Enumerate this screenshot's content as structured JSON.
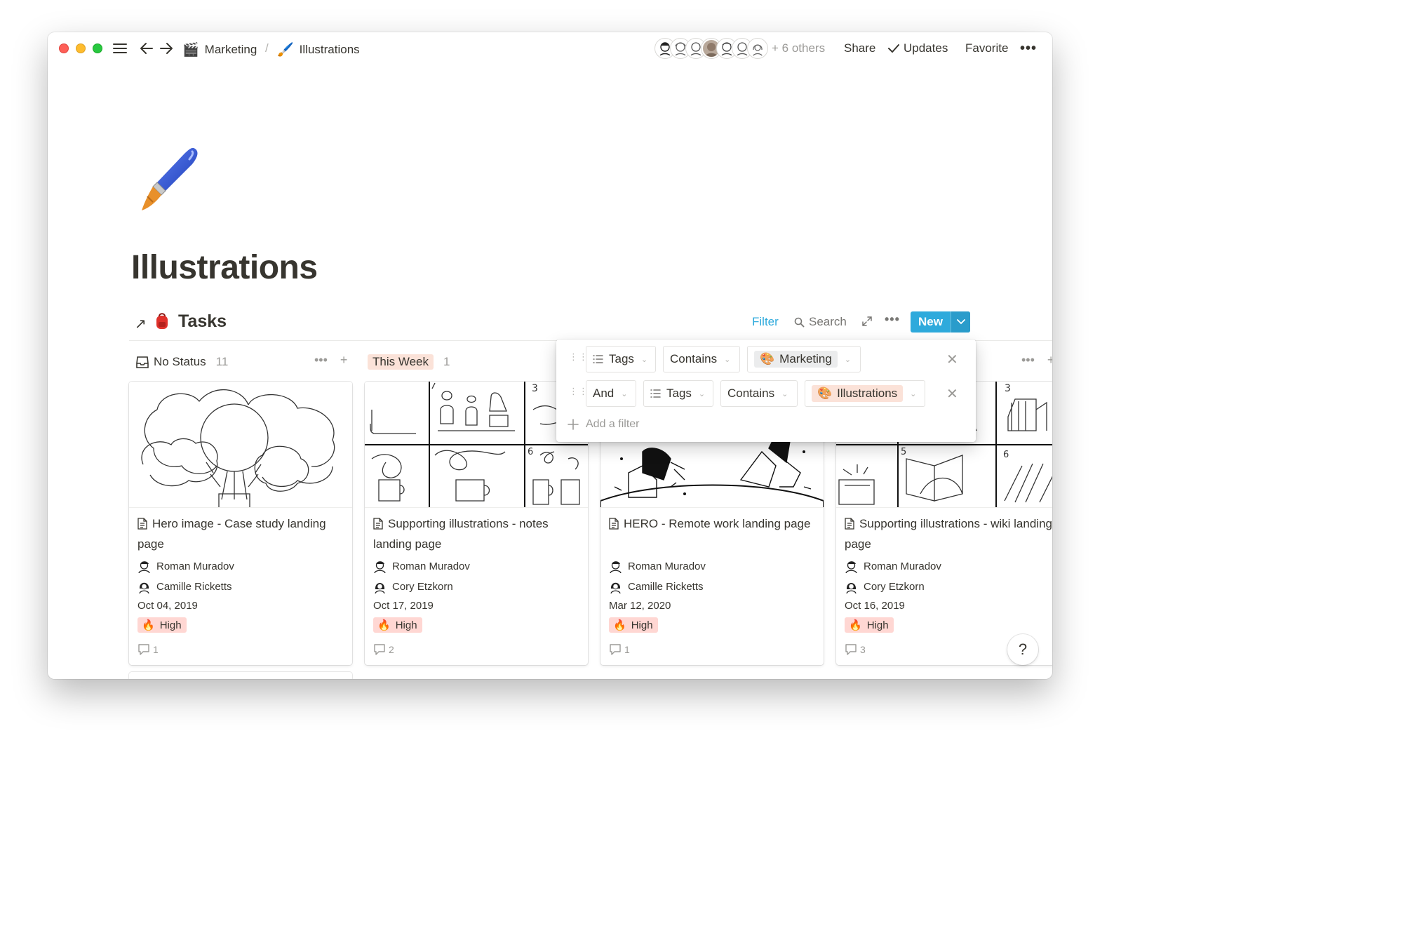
{
  "topbar": {
    "breadcrumb": [
      {
        "icon": "clapperboard-icon",
        "emoji": "🎬",
        "label": "Marketing"
      },
      {
        "icon": "paintbrush-icon",
        "emoji": "🖌️",
        "label": "Illustrations"
      }
    ],
    "separator": "/",
    "others": "+ 6 others",
    "share": "Share",
    "updates": "Updates",
    "favorite": "Favorite",
    "more": "•••"
  },
  "page": {
    "icon": "paintbrush-icon",
    "title": "Illustrations"
  },
  "database": {
    "link_arrow": "↗",
    "icon_emoji": "🎒",
    "title": "Tasks",
    "filter": "Filter",
    "search": "Search",
    "more": "•••",
    "new": "New"
  },
  "columns": [
    {
      "label": "No Status",
      "count": "11"
    },
    {
      "label": "This Week",
      "count": "1"
    }
  ],
  "cards": [
    {
      "title": "Hero image - Case study landing page",
      "people": [
        "Roman Muradov",
        "Camille Ricketts"
      ],
      "date": "Oct 04, 2019",
      "priority": "High",
      "comments": "1"
    },
    {
      "title": "Supporting illustrations - notes landing page",
      "people": [
        "Roman Muradov",
        "Cory Etzkorn"
      ],
      "date": "Oct 17, 2019",
      "priority": "High",
      "comments": "2"
    },
    {
      "title": "HERO - Remote work landing page",
      "people": [
        "Roman Muradov",
        "Camille Ricketts"
      ],
      "date": "Mar 12, 2020",
      "priority": "High",
      "comments": "1"
    },
    {
      "title": "Supporting illustrations - wiki landing page",
      "people": [
        "Roman Muradov",
        "Cory Etzkorn"
      ],
      "date": "Oct 16, 2019",
      "priority": "High",
      "comments": "3"
    }
  ],
  "filters": {
    "rows": [
      {
        "conjunction": "",
        "property": "Tags",
        "operator": "Contains",
        "value": "Marketing"
      },
      {
        "conjunction": "And",
        "property": "Tags",
        "operator": "Contains",
        "value": "Illustrations"
      }
    ],
    "add_filter": "Add a filter"
  },
  "help": "?",
  "colors": {
    "accent": "#2eaadc",
    "priority_bg": "#ffd7d3",
    "this_week_bg": "#fbe2d8",
    "text": "#37352f",
    "muted": "#9b9a97"
  }
}
